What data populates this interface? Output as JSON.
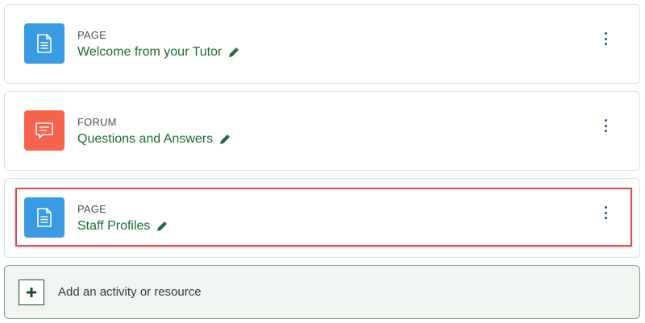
{
  "activities": [
    {
      "type_label": "PAGE",
      "title": "Welcome from your Tutor",
      "icon": "page-icon",
      "icon_color": "#399be2"
    },
    {
      "type_label": "FORUM",
      "title": "Questions and Answers",
      "icon": "forum-icon",
      "icon_color": "#f7634d"
    },
    {
      "type_label": "PAGE",
      "title": "Staff Profiles",
      "icon": "page-icon",
      "icon_color": "#399be2",
      "highlighted": true
    }
  ],
  "add_activity": {
    "label": "Add an activity or resource",
    "icon": "plus-icon"
  },
  "colors": {
    "title_link": "#1d6b3a",
    "highlight_border": "#de4a4a",
    "kebab": "#1f5288"
  }
}
